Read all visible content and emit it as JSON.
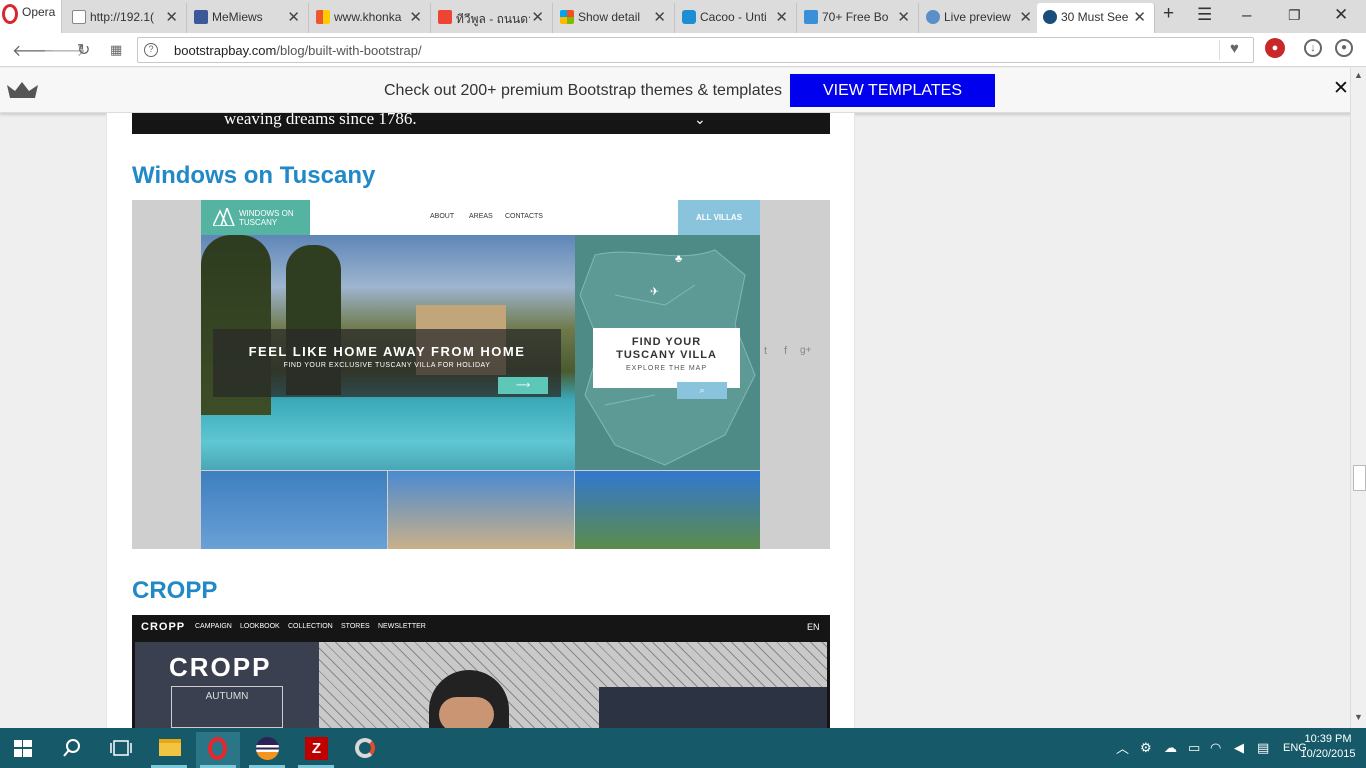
{
  "browser": {
    "menu_label": "Opera",
    "tabs": [
      {
        "label": "http://192.1(",
        "favicon": "page-icon"
      },
      {
        "label": "MeMiews",
        "favicon": "facebook-icon"
      },
      {
        "label": "www.khonka",
        "favicon": "kk-icon"
      },
      {
        "label": "ทีวีพูล - ถนนดา",
        "favicon": "tvpool-icon"
      },
      {
        "label": "Show detail",
        "favicon": "windows-icon"
      },
      {
        "label": "Cacoo - Unti",
        "favicon": "cacoo-icon"
      },
      {
        "label": "70+ Free Bo",
        "favicon": "f-icon"
      },
      {
        "label": "Live preview",
        "favicon": "live-preview-icon"
      },
      {
        "label": "30 Must See",
        "favicon": "bootstrapbay-icon"
      }
    ],
    "url_host": "bootstrapbay.com",
    "url_path": "/blog/built-with-bootstrap/"
  },
  "promo": {
    "message": "Check out 200+ premium Bootstrap themes & templates",
    "button": "VIEW TEMPLATES"
  },
  "article": {
    "prev_tagline": "weaving dreams since 1786.",
    "section1_title": "Windows on Tuscany",
    "section2_title": "CROPP",
    "tuscany": {
      "logo": "WINDOWS ON TUSCANY",
      "nav": [
        "ABOUT",
        "AREAS",
        "CONTACTS"
      ],
      "all_villas": "ALL VILLAS",
      "hero_title": "FEEL LIKE HOME AWAY FROM HOME",
      "hero_sub": "FIND YOUR EXCLUSIVE TUSCANY VILLA FOR HOLIDAY",
      "map_title_1": "FIND YOUR",
      "map_title_2": "TUSCANY VILLA",
      "map_sub": "EXPLORE THE MAP"
    },
    "cropp": {
      "logo": "CROPP",
      "nav": [
        "CAMPAIGN",
        "LOOKBOOK",
        "COLLECTION",
        "STORES",
        "NEWSLETTER"
      ],
      "lang": "EN",
      "hero_logo": "CROPP",
      "hero_sub": "AUTUMN"
    }
  },
  "taskbar": {
    "lang": "ENG",
    "time": "10:39 PM",
    "date": "10/20/2015"
  }
}
